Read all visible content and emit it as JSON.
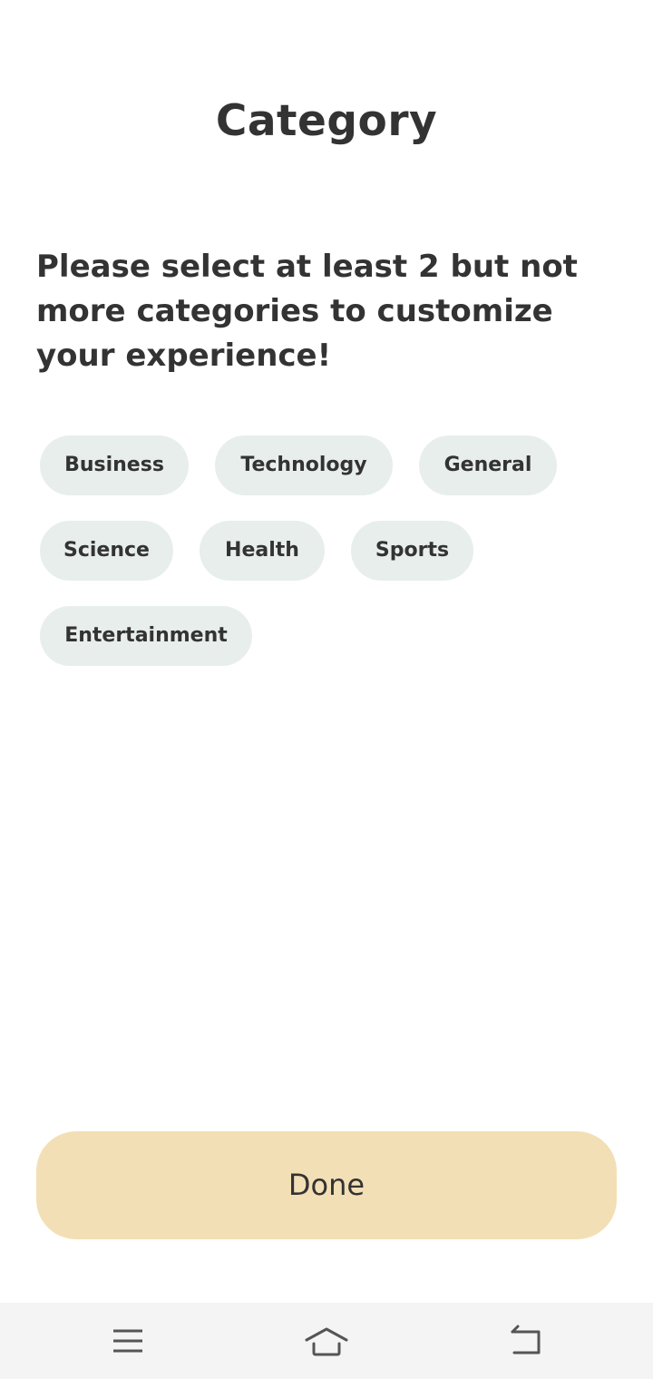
{
  "header": {
    "title": "Category"
  },
  "instruction": "Please select at least 2 but not more categories to customize your experience!",
  "categories": [
    {
      "label": "Business",
      "selected": false
    },
    {
      "label": "Technology",
      "selected": false
    },
    {
      "label": "General",
      "selected": false
    },
    {
      "label": "Science",
      "selected": false
    },
    {
      "label": "Health",
      "selected": false
    },
    {
      "label": "Sports",
      "selected": false
    },
    {
      "label": "Entertainment",
      "selected": false
    }
  ],
  "done_button": {
    "label": "Done"
  },
  "navbar": {
    "icons": [
      "menu-icon",
      "home-icon",
      "back-icon"
    ]
  },
  "colors": {
    "chip_bg": "#e8eeec",
    "done_bg": "#f3dfb5",
    "text": "#333333",
    "navbar_bg": "#f4f4f4"
  }
}
